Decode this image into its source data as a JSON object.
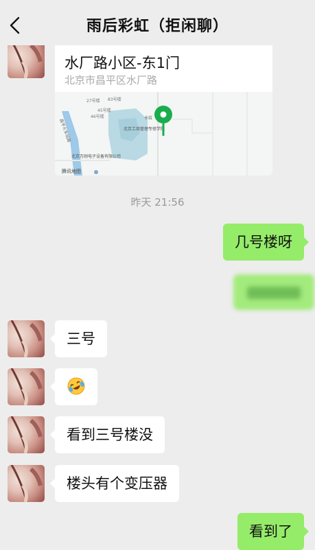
{
  "header": {
    "title": "雨后彩虹（拒闲聊）",
    "back_icon": "chevron-left-icon"
  },
  "location": {
    "title": "水厂路小区-东1门",
    "address": "北京市昌平区水厂路",
    "map_labels": {
      "poi_school": "北京工商管理专修学院",
      "poi_company": "北京万刚电子设备有限公司",
      "road_west": "昌平火车站路",
      "bldg_27": "27号楼",
      "bldg_45": "45号楼",
      "bldg_46": "46号楼",
      "bldg_83": "83号楼",
      "poi_kalai": "卡拉",
      "watermark": "腾讯地图"
    }
  },
  "timestamp": "昨天 21:56",
  "messages": [
    {
      "side": "right",
      "text": "几号楼呀"
    },
    {
      "side": "right",
      "text": "",
      "blurred": true
    },
    {
      "side": "left",
      "text": "三号"
    },
    {
      "side": "left",
      "emoji": "laughing-tears-emoji"
    },
    {
      "side": "left",
      "text": "看到三号楼没"
    },
    {
      "side": "left",
      "text": "楼头有个变压器"
    },
    {
      "side": "right",
      "text": "看到了"
    }
  ],
  "colors": {
    "background": "#ededed",
    "outgoing": "#95ec69",
    "incoming": "#ffffff",
    "map_pin": "#1aad4e"
  }
}
